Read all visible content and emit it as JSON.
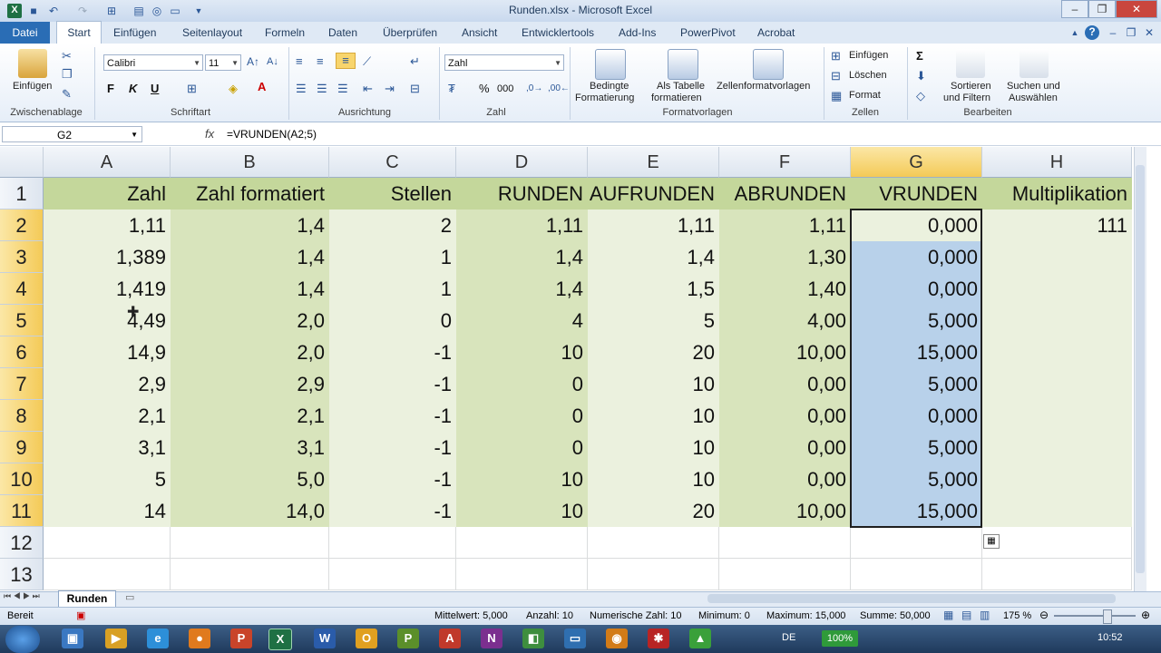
{
  "window": {
    "title": "Runden.xlsx - Microsoft Excel"
  },
  "tabs": [
    "Datei",
    "Start",
    "Einfügen",
    "Seitenlayout",
    "Formeln",
    "Daten",
    "Überprüfen",
    "Ansicht",
    "Entwicklertools",
    "Add-Ins",
    "PowerPivot",
    "Acrobat"
  ],
  "ribbon": {
    "clipboard": {
      "paste": "Einfügen",
      "label": "Zwischenablage"
    },
    "font": {
      "name": "Calibri",
      "size": "11",
      "bold": "F",
      "italic": "K",
      "underline": "U",
      "label": "Schriftart"
    },
    "alignment": {
      "label": "Ausrichtung"
    },
    "number": {
      "format": "Zahl",
      "percent": "%",
      "thousands": "000",
      "label": "Zahl"
    },
    "styles": {
      "conditional_1": "Bedingte",
      "conditional_2": "Formatierung",
      "table_1": "Als Tabelle",
      "table_2": "formatieren",
      "cellstyles": "Zellenformatvorlagen",
      "label": "Formatvorlagen"
    },
    "cells": {
      "insert": "Einfügen",
      "delete": "Löschen",
      "format": "Format",
      "label": "Zellen"
    },
    "editing": {
      "sigma": "Σ",
      "sort_1": "Sortieren",
      "sort_2": "und Filtern",
      "find_1": "Suchen und",
      "find_2": "Auswählen",
      "label": "Bearbeiten"
    }
  },
  "formula_bar": {
    "name_box": "G2",
    "fx": "fx",
    "formula": "=VRUNDEN(A2;5)"
  },
  "sheet": {
    "columns": [
      "A",
      "B",
      "C",
      "D",
      "E",
      "F",
      "G",
      "H"
    ],
    "rows": [
      "1",
      "2",
      "3",
      "4",
      "5",
      "6",
      "7",
      "8",
      "9",
      "10",
      "11",
      "12",
      "13"
    ],
    "header": [
      "Zahl",
      "Zahl formatiert",
      "Stellen",
      "RUNDEN",
      "AUFRUNDEN",
      "ABRUNDEN",
      "VRUNDEN",
      "Multiplikation"
    ],
    "data": [
      [
        "1,11",
        "1,4",
        "2",
        "1,11",
        "1,11",
        "1,11",
        "0,000",
        "111"
      ],
      [
        "1,389",
        "1,4",
        "1",
        "1,4",
        "1,4",
        "1,30",
        "0,000",
        ""
      ],
      [
        "1,419",
        "1,4",
        "1",
        "1,4",
        "1,5",
        "1,40",
        "0,000",
        ""
      ],
      [
        "4,49",
        "2,0",
        "0",
        "4",
        "5",
        "4,00",
        "5,000",
        ""
      ],
      [
        "14,9",
        "2,0",
        "-1",
        "10",
        "20",
        "10,00",
        "15,000",
        ""
      ],
      [
        "2,9",
        "2,9",
        "-1",
        "0",
        "10",
        "0,00",
        "5,000",
        ""
      ],
      [
        "2,1",
        "2,1",
        "-1",
        "0",
        "10",
        "0,00",
        "0,000",
        ""
      ],
      [
        "3,1",
        "3,1",
        "-1",
        "0",
        "10",
        "0,00",
        "5,000",
        ""
      ],
      [
        "5",
        "5,0",
        "-1",
        "10",
        "10",
        "0,00",
        "5,000",
        ""
      ],
      [
        "14",
        "14,0",
        "-1",
        "10",
        "20",
        "10,00",
        "15,000",
        ""
      ]
    ]
  },
  "sheet_tab": "Runden",
  "status": {
    "ready": "Bereit",
    "average": "Mittelwert: 5,000",
    "count": "Anzahl: 10",
    "numcount": "Numerische Zahl: 10",
    "min": "Minimum: 0",
    "max": "Maximum: 15,000",
    "sum": "Summe: 50,000",
    "zoom": "175 %"
  },
  "taskbar": {
    "lang": "DE",
    "battery": "100%",
    "time": "10:52"
  },
  "colors": {
    "header_green": "#c4d79b",
    "light_green": "#ebf1de",
    "mid_green": "#d8e4bc",
    "selection_blue": "#b8d1ea"
  }
}
